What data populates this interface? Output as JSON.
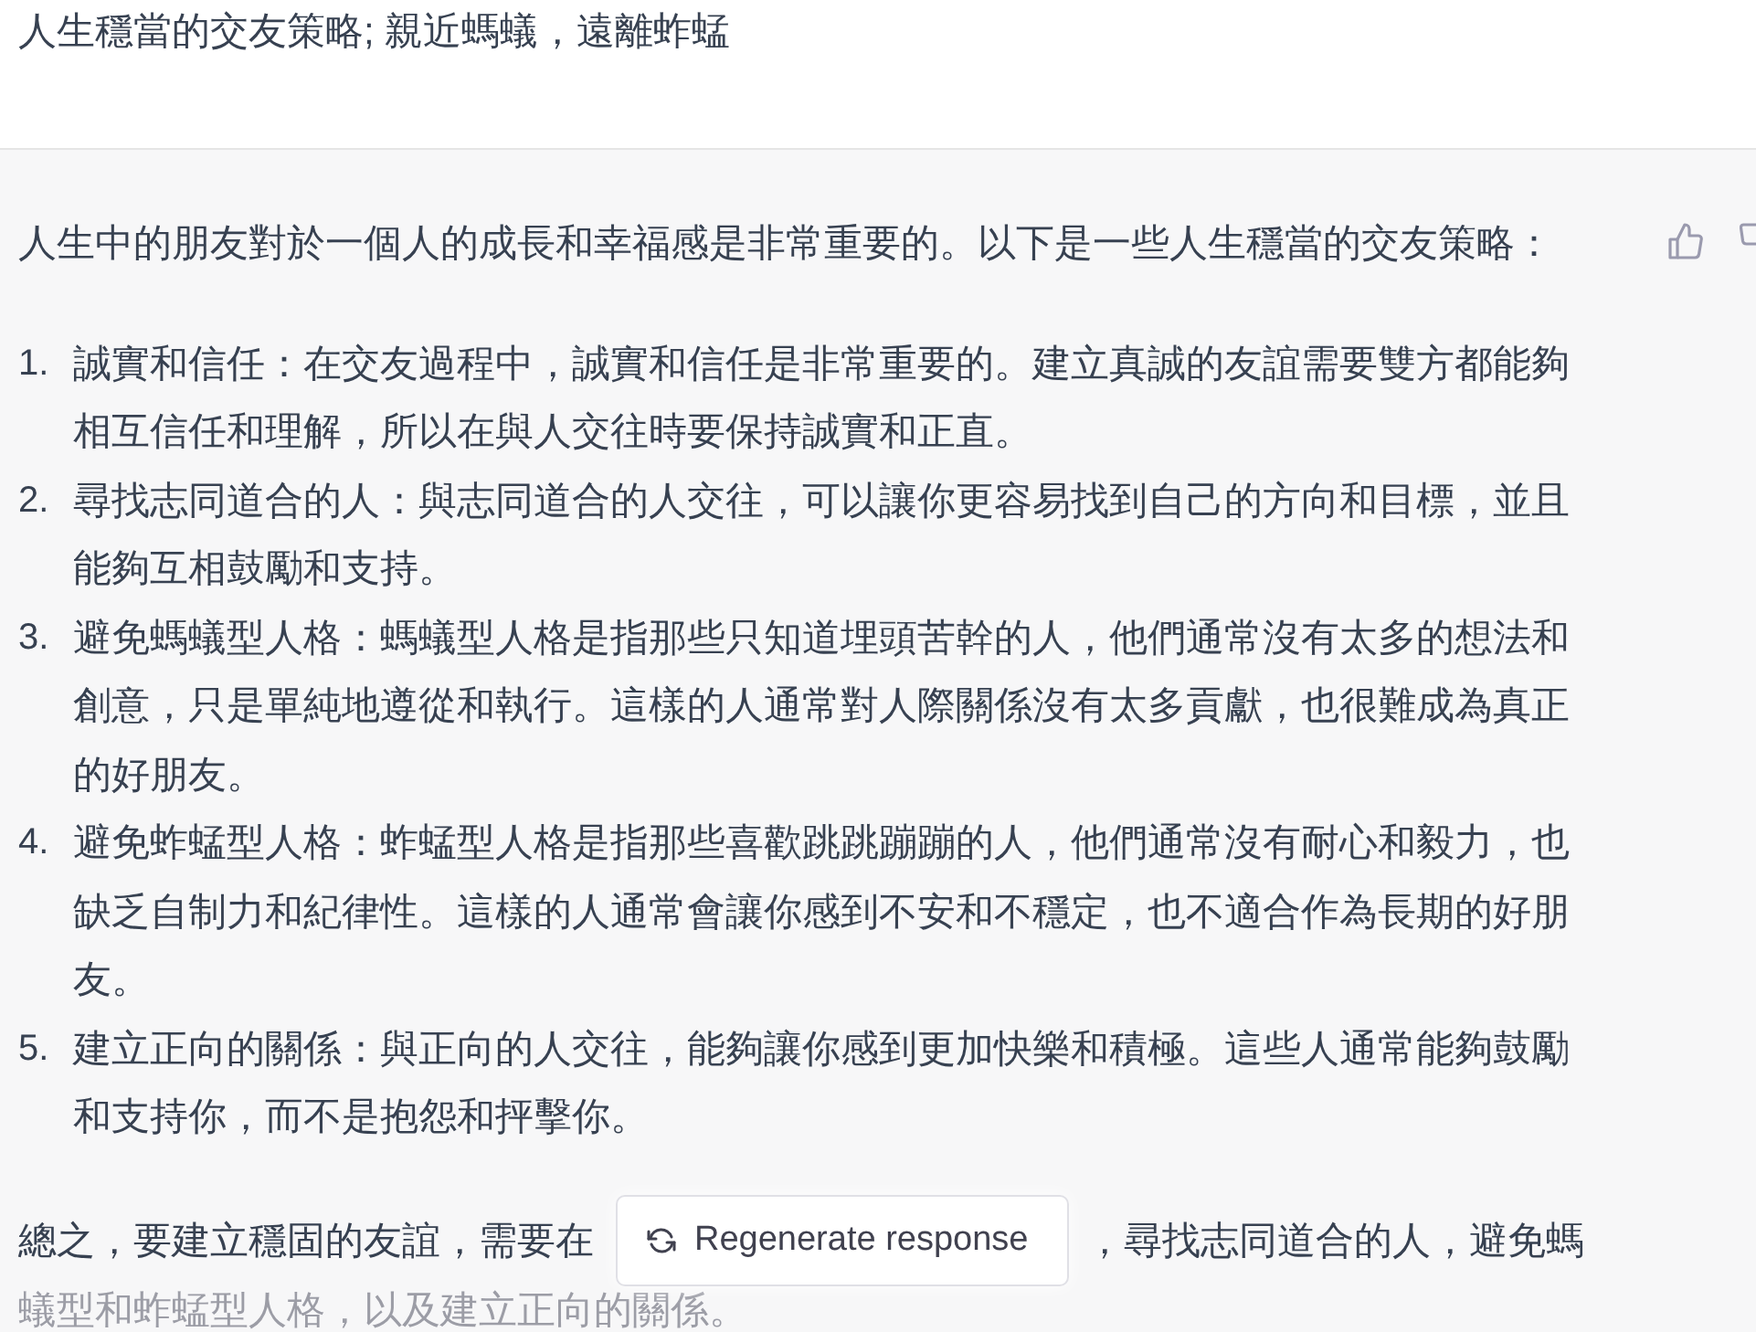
{
  "prompt": {
    "text": "人生穩當的交友策略; 親近螞蟻，遠離蚱蜢"
  },
  "response": {
    "intro": "人生中的朋友對於一個人的成長和幸福感是非常重要的。以下是一些人生穩當的交友策略：",
    "items": [
      {
        "number": "1.",
        "text": "誠實和信任：在交友過程中，誠實和信任是非常重要的。建立真誠的友誼需要雙方都能夠相互信任和理解，所以在與人交往時要保持誠實和正直。"
      },
      {
        "number": "2.",
        "text": "尋找志同道合的人：與志同道合的人交往，可以讓你更容易找到自己的方向和目標，並且能夠互相鼓勵和支持。"
      },
      {
        "number": "3.",
        "text": "避免螞蟻型人格：螞蟻型人格是指那些只知道埋頭苦幹的人，他們通常沒有太多的想法和創意，只是單純地遵從和執行。這樣的人通常對人際關係沒有太多貢獻，也很難成為真正的好朋友。"
      },
      {
        "number": "4.",
        "text": "避免蚱蜢型人格：蚱蜢型人格是指那些喜歡跳跳蹦蹦的人，他們通常沒有耐心和毅力，也缺乏自制力和紀律性。這樣的人通常會讓你感到不安和不穩定，也不適合作為長期的好朋友。"
      },
      {
        "number": "5.",
        "text": "建立正向的關係：與正向的人交往，能夠讓你感到更加快樂和積極。這些人通常能夠鼓勵和支持你，而不是抱怨和抨擊你。"
      }
    ],
    "conclusion": {
      "line_1_start": "總之，要建立穩固的友誼，需要在",
      "line_1_end": "，尋找志同道合的人，避免螞",
      "line_2": "蟻型和蚱蜢型人格，以及建立正向的關係。"
    }
  },
  "regenerate_button": {
    "label": "Regenerate response"
  }
}
